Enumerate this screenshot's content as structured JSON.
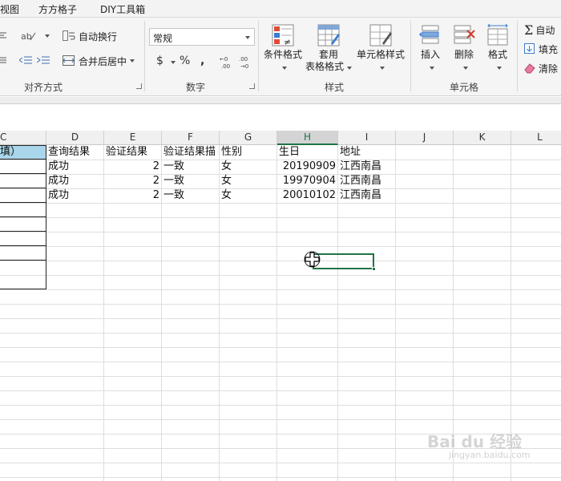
{
  "tabs": [
    "视图",
    "方方格子",
    "DIY工具箱"
  ],
  "ribbon": {
    "alignment": {
      "wrap_text": "自动换行",
      "merge_center": "合并后居中",
      "group_label": "对齐方式"
    },
    "number": {
      "format_value": "常规",
      "currency_symbol": "$",
      "percent_symbol": "%",
      "comma_symbol": ",",
      "group_label": "数字"
    },
    "styles": {
      "conditional_format": "条件格式",
      "table_format_line1": "套用",
      "table_format_line2": "表格格式",
      "cell_styles": "单元格样式",
      "group_label": "样式"
    },
    "cells": {
      "insert": "插入",
      "delete": "删除",
      "format": "格式",
      "group_label": "单元格"
    },
    "editing": {
      "autosum": "自动",
      "fill": "填充",
      "clear": "清除"
    }
  },
  "sheet": {
    "columns": [
      "C",
      "D",
      "E",
      "F",
      "G",
      "H",
      "I",
      "J",
      "K",
      "L"
    ],
    "selected_column": "H",
    "c_header_partial": "填）",
    "header_row": [
      "查询结果",
      "验证结果",
      "验证结果描",
      "性别",
      "生日",
      "地址"
    ],
    "rows": [
      [
        "成功",
        "2",
        "一致",
        "女",
        "20190909",
        "江西南昌"
      ],
      [
        "成功",
        "2",
        "一致",
        "女",
        "19970904",
        "江西南昌"
      ],
      [
        "成功",
        "2",
        "一致",
        "女",
        "20010102",
        "江西南昌"
      ]
    ]
  },
  "watermark": {
    "brand": "Bai du 经验",
    "url": "jingyan.baidu.com"
  },
  "colors": {
    "accent": "#217346",
    "header_fill": "#a9d6ea"
  }
}
